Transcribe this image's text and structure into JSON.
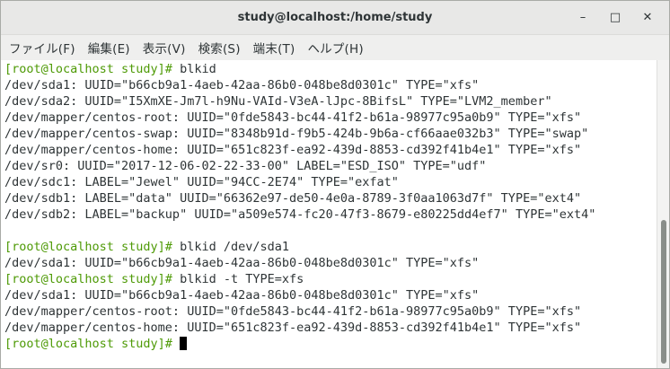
{
  "window": {
    "title": "study@localhost:/home/study",
    "controls": {
      "minimize": "–",
      "maximize": "□",
      "close": "✕"
    }
  },
  "menu": [
    "ファイル(F)",
    "編集(E)",
    "表示(V)",
    "検索(S)",
    "端末(T)",
    "ヘルプ(H)"
  ],
  "terminal": {
    "lines": [
      {
        "prompt": "[root@localhost study]# ",
        "text": "blkid"
      },
      {
        "prompt": "",
        "text": "/dev/sda1: UUID=\"b66cb9a1-4aeb-42aa-86b0-048be8d0301c\" TYPE=\"xfs\""
      },
      {
        "prompt": "",
        "text": "/dev/sda2: UUID=\"I5XmXE-Jm7l-h9Nu-VAId-V3eA-lJpc-8BifsL\" TYPE=\"LVM2_member\""
      },
      {
        "prompt": "",
        "text": "/dev/mapper/centos-root: UUID=\"0fde5843-bc44-41f2-b61a-98977c95a0b9\" TYPE=\"xfs\""
      },
      {
        "prompt": "",
        "text": "/dev/mapper/centos-swap: UUID=\"8348b91d-f9b5-424b-9b6a-cf66aae032b3\" TYPE=\"swap\""
      },
      {
        "prompt": "",
        "text": "/dev/mapper/centos-home: UUID=\"651c823f-ea92-439d-8853-cd392f41b4e1\" TYPE=\"xfs\""
      },
      {
        "prompt": "",
        "text": "/dev/sr0: UUID=\"2017-12-06-02-22-33-00\" LABEL=\"ESD_ISO\" TYPE=\"udf\""
      },
      {
        "prompt": "",
        "text": "/dev/sdc1: LABEL=\"Jewel\" UUID=\"94CC-2E74\" TYPE=\"exfat\""
      },
      {
        "prompt": "",
        "text": "/dev/sdb1: LABEL=\"data\" UUID=\"66362e97-de50-4e0a-8789-3f0aa1063d7f\" TYPE=\"ext4\""
      },
      {
        "prompt": "",
        "text": "/dev/sdb2: LABEL=\"backup\" UUID=\"a509e574-fc20-47f3-8679-e80225dd4ef7\" TYPE=\"ext4\""
      },
      {
        "prompt": "",
        "text": ""
      },
      {
        "prompt": "[root@localhost study]# ",
        "text": "blkid /dev/sda1"
      },
      {
        "prompt": "",
        "text": "/dev/sda1: UUID=\"b66cb9a1-4aeb-42aa-86b0-048be8d0301c\" TYPE=\"xfs\""
      },
      {
        "prompt": "[root@localhost study]# ",
        "text": "blkid -t TYPE=xfs"
      },
      {
        "prompt": "",
        "text": "/dev/sda1: UUID=\"b66cb9a1-4aeb-42aa-86b0-048be8d0301c\" TYPE=\"xfs\""
      },
      {
        "prompt": "",
        "text": "/dev/mapper/centos-root: UUID=\"0fde5843-bc44-41f2-b61a-98977c95a0b9\" TYPE=\"xfs\""
      },
      {
        "prompt": "",
        "text": "/dev/mapper/centos-home: UUID=\"651c823f-ea92-439d-8853-cd392f41b4e1\" TYPE=\"xfs\""
      },
      {
        "prompt": "[root@localhost study]# ",
        "text": "",
        "cursor": true
      }
    ]
  },
  "colors": {
    "prompt": "#4e9a06",
    "text": "#2e3436",
    "terminal_bg": "#ffffff"
  }
}
